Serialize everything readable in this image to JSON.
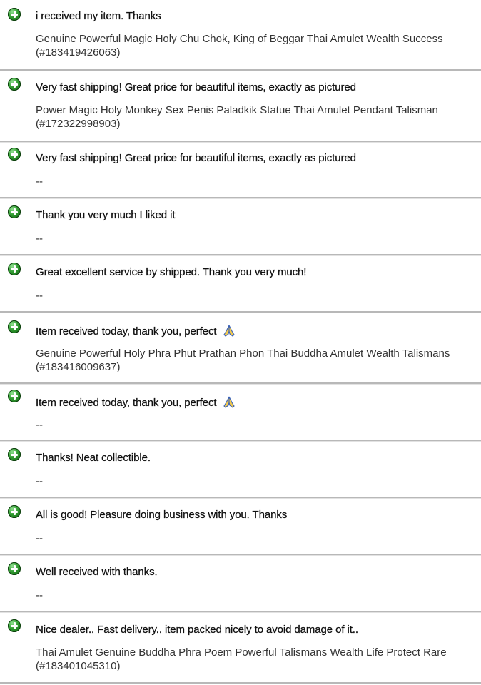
{
  "feedback": [
    {
      "comment": "i received my item. Thanks",
      "item_line1": "Genuine Powerful Magic Holy Chu Chok, King of Beggar Thai Amulet Wealth Success",
      "item_line2": "(#183419426063)",
      "emoji": ""
    },
    {
      "comment": "Very fast shipping! Great price for beautiful items, exactly as pictured",
      "item_line1": "Power Magic Holy Monkey Sex Penis Paladkik Statue Thai Amulet Pendant Talisman",
      "item_line2": "(#172322998903)",
      "emoji": ""
    },
    {
      "comment": "Very fast shipping! Great price for beautiful items, exactly as pictured",
      "item_line1": "--",
      "item_line2": "",
      "emoji": ""
    },
    {
      "comment": "Thank you very much I liked it",
      "item_line1": "--",
      "item_line2": "",
      "emoji": ""
    },
    {
      "comment": "Great excellent service by shipped. Thank you very much!",
      "item_line1": "--",
      "item_line2": "",
      "emoji": ""
    },
    {
      "comment": "Item received today, thank you, perfect",
      "item_line1": "Genuine Powerful Holy Phra Phut Prathan Phon Thai Buddha Amulet Wealth Talismans",
      "item_line2": "(#183416009637)",
      "emoji": "folded-hands-icon"
    },
    {
      "comment": "Item received today, thank you, perfect",
      "item_line1": "--",
      "item_line2": "",
      "emoji": "folded-hands-icon"
    },
    {
      "comment": "Thanks! Neat collectible.",
      "item_line1": "--",
      "item_line2": "",
      "emoji": ""
    },
    {
      "comment": "All is good! Pleasure doing business with you. Thanks",
      "item_line1": "--",
      "item_line2": "",
      "emoji": ""
    },
    {
      "comment": "Well received with thanks.",
      "item_line1": "--",
      "item_line2": "",
      "emoji": ""
    },
    {
      "comment": "Nice dealer.. Fast delivery.. item packed nicely to avoid damage of it..",
      "item_line1": "Thai Amulet Genuine Buddha Phra Poem Powerful Talismans Wealth Life Protect Rare",
      "item_line2": "(#183401045310)",
      "emoji": ""
    }
  ],
  "icons": {
    "rating": "positive-feedback-plus-icon",
    "emoji": "folded-hands-icon"
  },
  "colors": {
    "positive_green": "#2f9a2f",
    "divider": "#b8b8b8"
  }
}
